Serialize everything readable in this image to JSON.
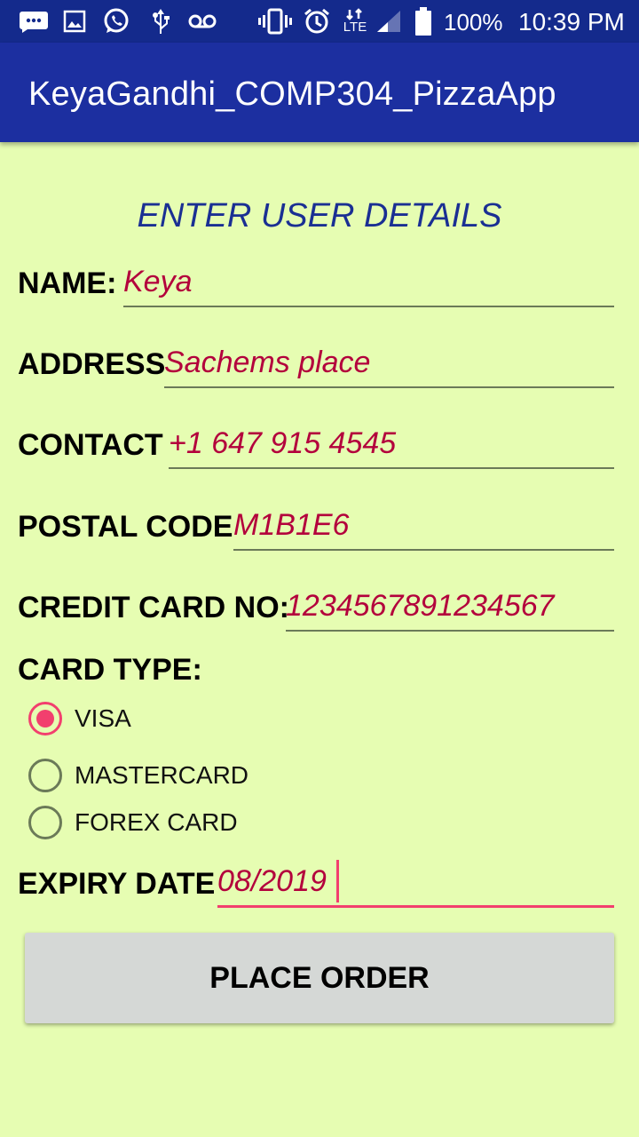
{
  "status_bar": {
    "battery": "100%",
    "time": "10:39 PM",
    "network": "LTE",
    "icons": [
      "chat-icon",
      "image-icon",
      "whatsapp-icon",
      "usb-icon",
      "voicemail-icon",
      "vibrate-icon",
      "alarm-icon",
      "signal-icon",
      "battery-icon"
    ]
  },
  "app_bar": {
    "title": "KeyaGandhi_COMP304_PizzaApp"
  },
  "form": {
    "heading": "ENTER USER DETAILS",
    "name": {
      "label": "NAME:",
      "value": "Keya"
    },
    "address": {
      "label": "ADDRESS",
      "value": "Sachems place"
    },
    "contact": {
      "label": "CONTACT",
      "value": "+1 647 915 4545"
    },
    "postal_code": {
      "label": "POSTAL CODE",
      "value": "M1B1E6"
    },
    "credit_card": {
      "label": "CREDIT CARD NO:",
      "value": "1234567891234567"
    },
    "card_type": {
      "label": "CARD TYPE:",
      "options": [
        {
          "label": "VISA",
          "checked": true
        },
        {
          "label": "MASTERCARD",
          "checked": false
        },
        {
          "label": "FOREX CARD",
          "checked": false
        }
      ]
    },
    "expiry_date": {
      "label": "EXPIRY DATE",
      "value": "08/2019"
    },
    "submit_label": "PLACE ORDER"
  },
  "colors": {
    "status_bar": "#142a8c",
    "app_bar": "#1c2fa0",
    "background": "#e6fdb2",
    "accent": "#f23f6e",
    "input_text": "#b3003c",
    "heading": "#1a2f93"
  }
}
